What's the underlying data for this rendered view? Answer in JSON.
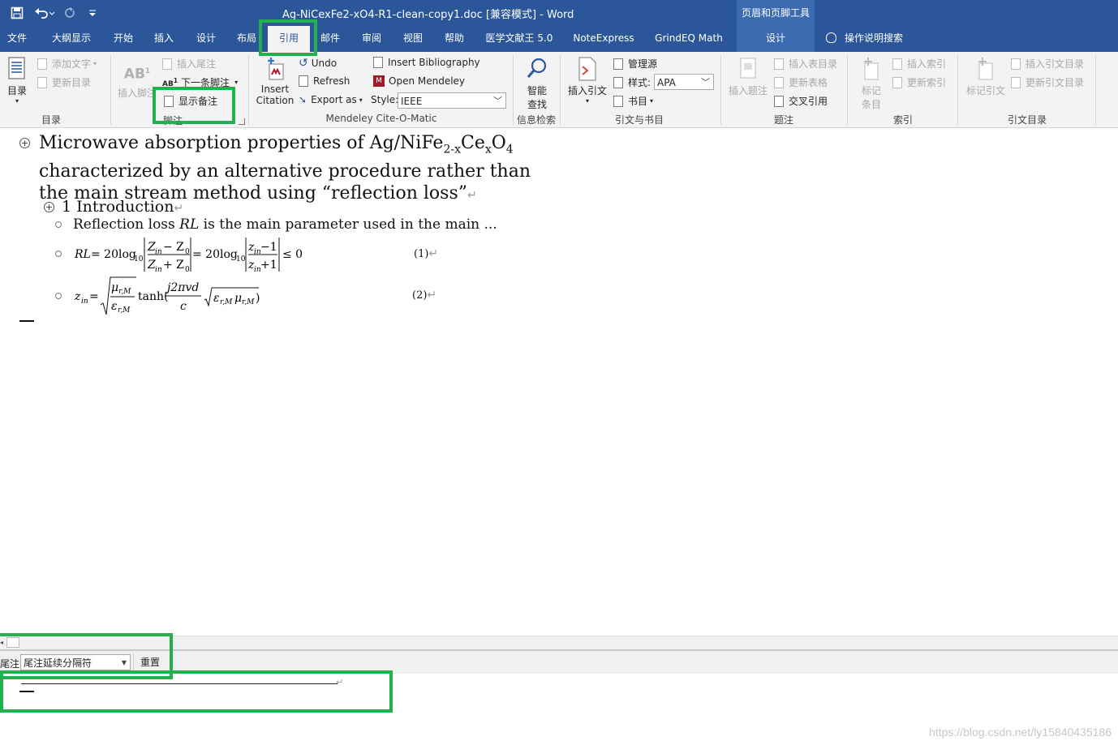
{
  "window": {
    "title": "Ag-NiCexFe2-xO4-R1-clean-copy1.doc [兼容模式]  -  Word",
    "contextual_tools_label": "页眉和页脚工具"
  },
  "tabs": [
    "文件",
    "大纲显示",
    "开始",
    "插入",
    "设计",
    "布局",
    "引用",
    "邮件",
    "审阅",
    "视图",
    "帮助",
    "医学文献王 5.0",
    "NoteExpress",
    "GrindEQ Math",
    "设计"
  ],
  "active_tab": "引用",
  "tell_me": "操作说明搜索",
  "ribbon": {
    "toc": {
      "toc_button": "目录",
      "add_text": "添加文字",
      "update_toc": "更新目录",
      "group": "目录"
    },
    "footnotes": {
      "insert_footnote": "插入脚注",
      "insert_endnote": "插入尾注",
      "next_footnote": "下一条脚注",
      "show_notes": "显示备注",
      "group": "脚注"
    },
    "mendeley": {
      "insert_citation_line1": "Insert",
      "insert_citation_line2": "Citation",
      "undo": "Undo",
      "refresh": "Refresh",
      "export_as": "Export as",
      "insert_bibliography": "Insert Bibliography",
      "open_mendeley": "Open Mendeley",
      "style_label": "Style:",
      "style_value": "IEEE",
      "group": "Mendeley Cite-O-Matic"
    },
    "research": {
      "smart_lookup_line1": "智能",
      "smart_lookup_line2": "查找",
      "group": "信息检索"
    },
    "citations": {
      "insert_citation": "插入引文",
      "manage_sources": "管理源",
      "style_label": "样式:",
      "style_value": "APA",
      "bibliography": "书目",
      "group": "引文与书目"
    },
    "captions": {
      "insert_caption": "插入题注",
      "insert_table_of_figures": "插入表目录",
      "update_table": "更新表格",
      "cross_reference": "交叉引用",
      "group": "题注"
    },
    "index": {
      "mark_entry_line1": "标记",
      "mark_entry_line2": "条目",
      "insert_index": "插入索引",
      "update_index": "更新索引",
      "group": "索引"
    },
    "toa": {
      "mark_citation": "标记引文",
      "insert_toa": "插入引文目录",
      "update_toa": "更新引文目录",
      "group": "引文目录"
    }
  },
  "document": {
    "title_line1": "Microwave absorption properties of Ag/NiFe",
    "title_sub1": "2-x",
    "title_mid": "Ce",
    "title_sub2": "x",
    "title_end": "O",
    "title_sub3": "4",
    "title_line2": "characterized by an alternative procedure rather than",
    "title_line3": "the main stream method using “reflection loss”",
    "heading": "1 Introduction",
    "bullet1_a": "Reflection loss ",
    "bullet1_rl": "RL",
    "bullet1_b": " is the main parameter used in the main ...",
    "eq1_number": "(1)",
    "eq2_number": "(2)",
    "eq1": {
      "lhs": "RL",
      "eq": " = 20log",
      "sub10": "10",
      "num1": "Z",
      "num1_sub": "in",
      "minus_z0": " − Z",
      "z0_sub": "0",
      "den_plus": " + Z",
      "mid": " = 20log",
      "num2": "z",
      "num2_rest": " −1",
      "den2_rest": " +1",
      "le0": "≤ 0"
    },
    "eq2": {
      "lhs": "z",
      "lhs_sub": "in",
      "eq": " =",
      "mu": "μ",
      "mu_sub": "r,M",
      "eps": "ε",
      "eps_sub": "r,M",
      "tanh": "tanh(",
      "num": "j2πvd",
      "den": "c",
      "close": ")"
    }
  },
  "notes_pane": {
    "label": "尾注",
    "selected": "尾注延续分隔符",
    "reset": "重置"
  },
  "watermark": "https://blog.csdn.net/ly15840435186",
  "colors": {
    "title_bar": "#2b579a",
    "highlight": "#22b14c"
  }
}
